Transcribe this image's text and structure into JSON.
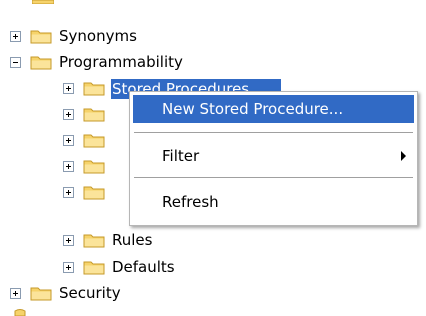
{
  "tree": {
    "items": [
      {
        "label": "Synonyms",
        "expander": "plus"
      },
      {
        "label": "Programmability",
        "expander": "minus"
      },
      {
        "label": "Stored Procedures",
        "expander": "plus",
        "selected": true
      },
      {
        "label": "",
        "expander": "plus"
      },
      {
        "label": "",
        "expander": "plus"
      },
      {
        "label": "",
        "expander": "plus"
      },
      {
        "label": "",
        "expander": "plus"
      },
      {
        "label": "Rules",
        "expander": "plus"
      },
      {
        "label": "Defaults",
        "expander": "plus"
      },
      {
        "label": "Security",
        "expander": "plus"
      }
    ]
  },
  "context_menu": {
    "new_stored_procedure": "New Stored Procedure...",
    "filter": "Filter",
    "refresh": "Refresh"
  },
  "colors": {
    "selection": "#316ac5",
    "folder_fill": "#f6d36b",
    "folder_stroke": "#c69a2a",
    "expander_border": "#8a9bb0"
  },
  "icons": {
    "expander_plus": "plus-box-icon",
    "expander_minus": "minus-box-icon",
    "folder": "folder-icon",
    "submenu": "chevron-right-icon"
  }
}
